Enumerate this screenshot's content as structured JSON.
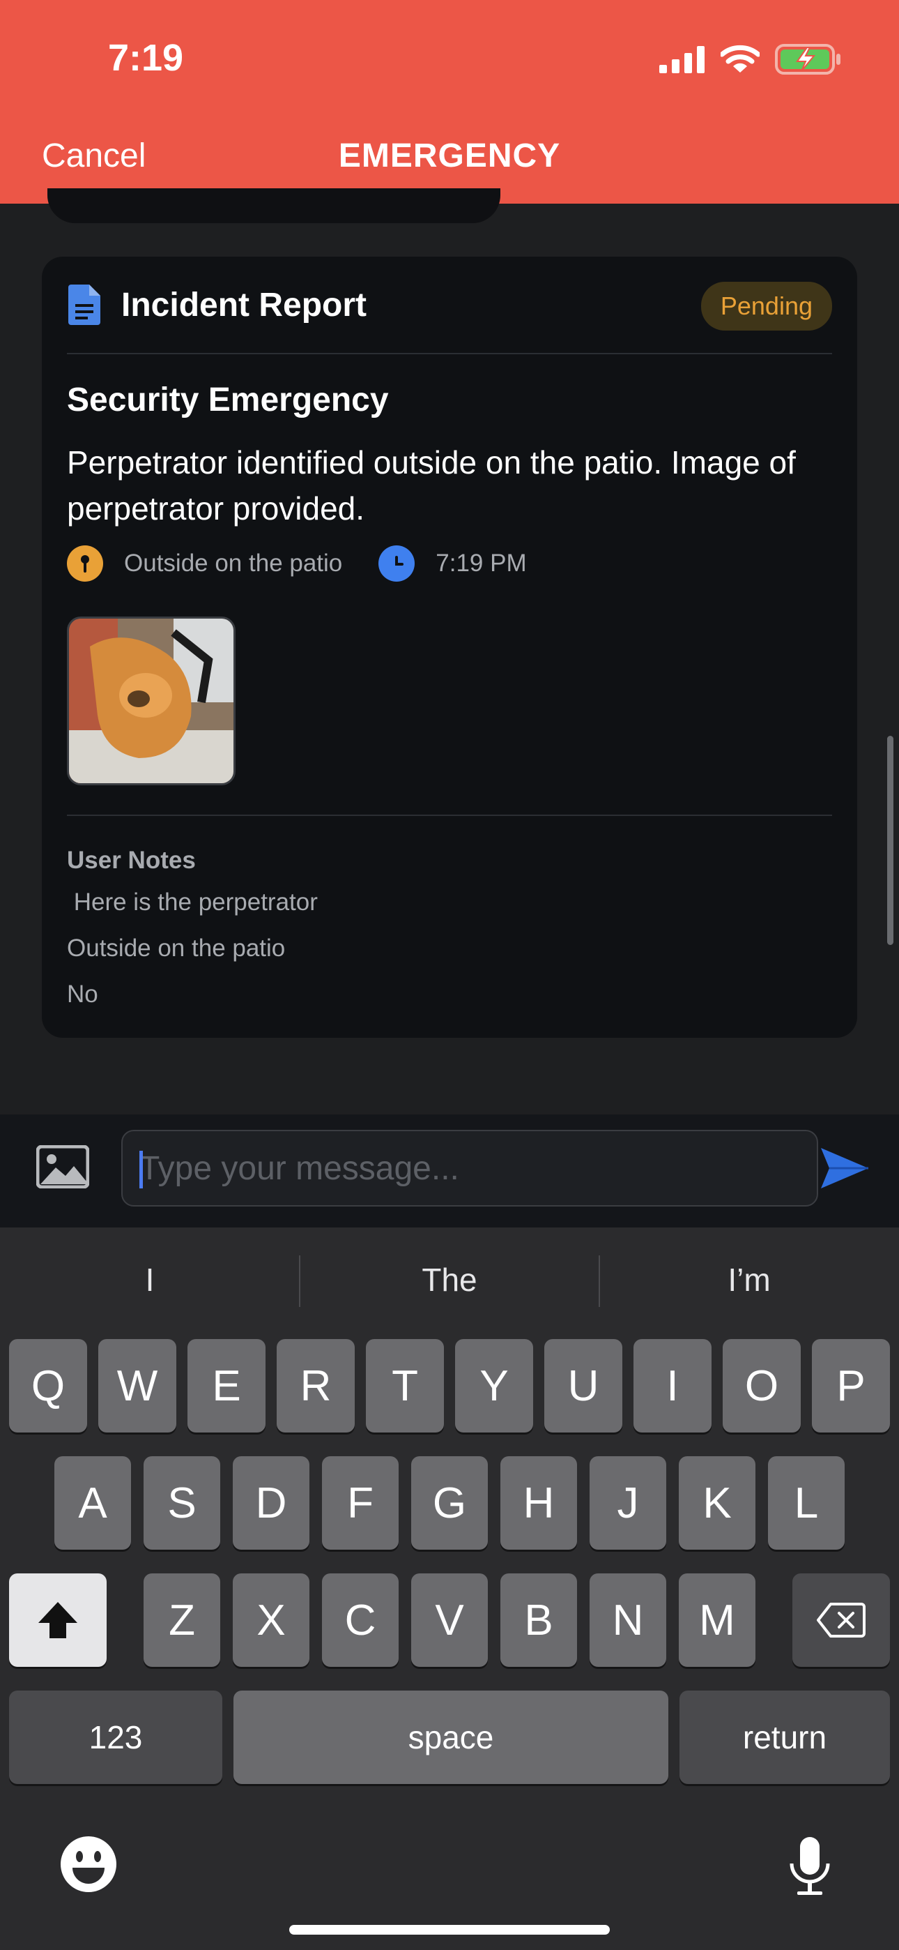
{
  "status_bar": {
    "time": "7:19"
  },
  "header": {
    "cancel_label": "Cancel",
    "title": "EMERGENCY",
    "color": "#ec5647"
  },
  "card": {
    "title": "Incident Report",
    "badge": "Pending",
    "subtitle": "Security Emergency",
    "description": "Perpetrator identified outside on the patio. Image of perpetrator provided.",
    "location": "Outside on the patio",
    "time": "7:19 PM",
    "notes_label": "User Notes",
    "notes": [
      " Here is the perpetrator",
      "Outside on the patio",
      "No"
    ]
  },
  "composer": {
    "placeholder": "Type your message..."
  },
  "keyboard": {
    "suggestions": [
      "I",
      "The",
      "I’m"
    ],
    "row1": [
      "Q",
      "W",
      "E",
      "R",
      "T",
      "Y",
      "U",
      "I",
      "O",
      "P"
    ],
    "row2": [
      "A",
      "S",
      "D",
      "F",
      "G",
      "H",
      "J",
      "K",
      "L"
    ],
    "row3": [
      "Z",
      "X",
      "C",
      "V",
      "B",
      "N",
      "M"
    ],
    "numbers_label": "123",
    "space_label": "space",
    "return_label": "return"
  }
}
